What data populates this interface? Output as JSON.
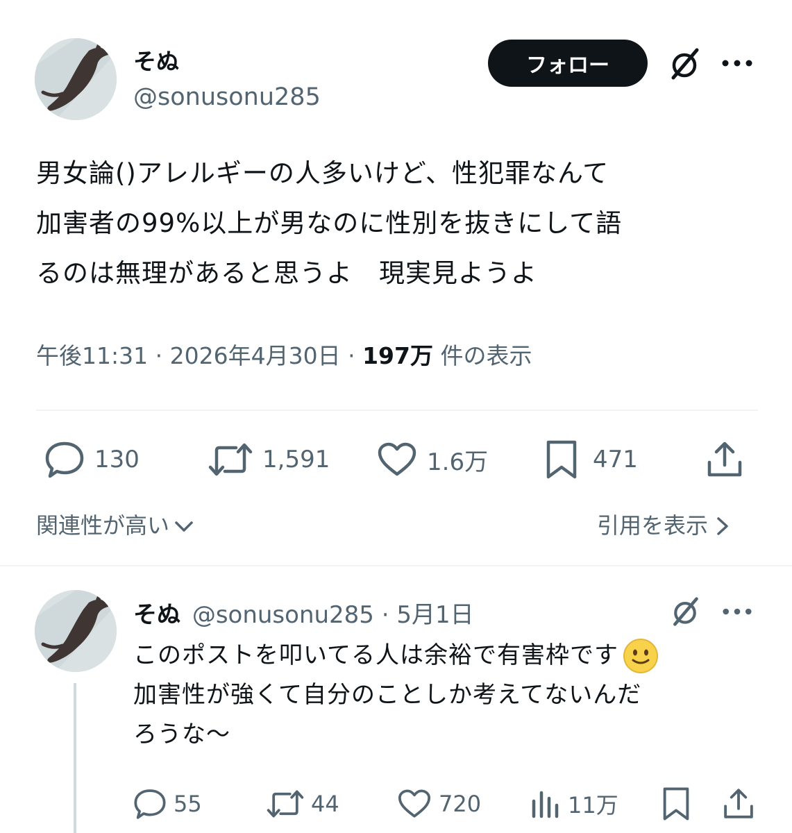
{
  "post": {
    "display_name": "そぬ",
    "handle": "@sonusonu285",
    "follow_label": "フォロー",
    "text_lines": [
      "男女論()アレルギーの人多いけど、性犯罪なんて",
      "加害者の99%以上が男なのに性別を抜きにして語",
      "るのは無理があると思うよ　現実見ようよ"
    ],
    "time": "午後11:31",
    "date": "2026年4月30日",
    "views_count": "197万",
    "views_label": "件の表示",
    "separator": "·",
    "replies": "130",
    "reposts": "1,591",
    "likes": "1.6万",
    "bookmarks": "471"
  },
  "filters": {
    "sort_label": "関連性が高い",
    "quotes_label": "引用を表示"
  },
  "reply": {
    "display_name": "そぬ",
    "handle": "@sonusonu285",
    "separator": "·",
    "date": "5月1日",
    "text_lines": [
      "このポストを叩いてる人は余裕で有害枠です",
      "加害性が強くて自分のことしか考えてないんだ",
      "ろうな〜"
    ],
    "replies": "55",
    "reposts": "44",
    "likes": "720",
    "views": "11万"
  },
  "icons": {
    "grok": "grok-slash-icon",
    "more": "more-dots-icon",
    "reply": "reply-bubble-icon",
    "repost": "repost-arrows-icon",
    "like": "heart-icon",
    "bookmark": "bookmark-icon",
    "share": "share-upload-icon",
    "views": "views-bar-chart-icon",
    "emoji": "slightly-smiling-face-emoji"
  },
  "colors": {
    "text": "#0f1419",
    "muted": "#536471",
    "divider": "#eff3f4",
    "follow_bg": "#0f1419"
  }
}
